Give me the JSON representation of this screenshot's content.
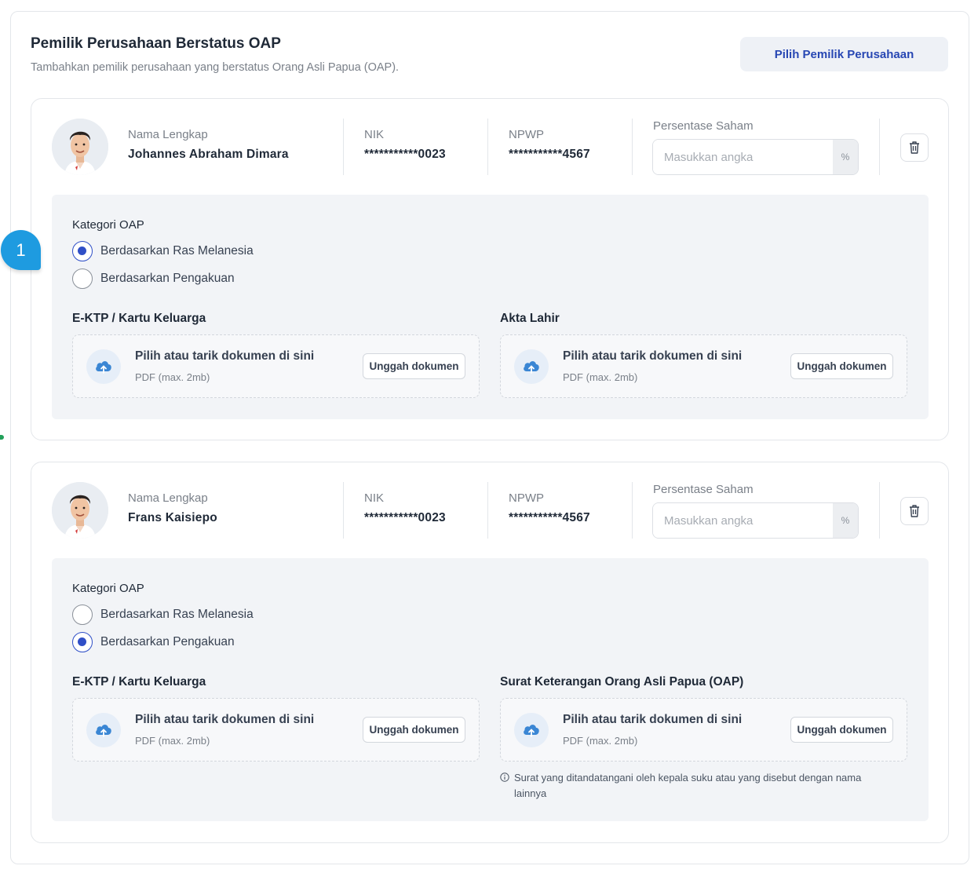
{
  "section": {
    "title": "Pemilik Perusahaan Berstatus OAP",
    "subtitle": "Tambahkan pemilik perusahaan yang berstatus Orang Asli Papua (OAP).",
    "pick_button": "Pilih Pemilik Perusahaan"
  },
  "labels": {
    "name": "Nama Lengkap",
    "nik": "NIK",
    "npwp": "NPWP",
    "saham": "Persentase Saham",
    "saham_placeholder": "Masukkan angka",
    "saham_suffix": "%",
    "kategori": "Kategori OAP",
    "radio_ras": "Berdasarkan Ras Melanesia",
    "radio_pengakuan": "Berdasarkan Pengakuan",
    "dz_main": "Pilih atau tarik dokumen di sini",
    "dz_sub": "PDF (max. 2mb)",
    "dz_button": "Unggah dokumen"
  },
  "owners": [
    {
      "name": "Johannes Abraham Dimara",
      "nik": "***********0023",
      "npwp": "***********4567",
      "saham_value": "",
      "kategori_selected": "ras",
      "uploads": [
        {
          "title": "E-KTP / Kartu Keluarga"
        },
        {
          "title": "Akta Lahir"
        }
      ]
    },
    {
      "name": "Frans Kaisiepo",
      "nik": "***********0023",
      "npwp": "***********4567",
      "saham_value": "",
      "kategori_selected": "pengakuan",
      "uploads": [
        {
          "title": "E-KTP / Kartu Keluarga"
        },
        {
          "title": "Surat Keterangan Orang Asli Papua (OAP)"
        }
      ],
      "note": "Surat yang ditandatangani oleh kepala suku atau yang disebut dengan nama lainnya"
    }
  ],
  "step_badge": "1",
  "colors": {
    "accent": "#2f4fc7",
    "button_text": "#2747b3",
    "badge": "#1e9be0",
    "panel_bg": "#f2f4f7"
  },
  "icons": {
    "avatar": "avatar-illustration",
    "trash": "trash-icon",
    "upload": "cloud-upload-icon",
    "info": "info-icon"
  }
}
